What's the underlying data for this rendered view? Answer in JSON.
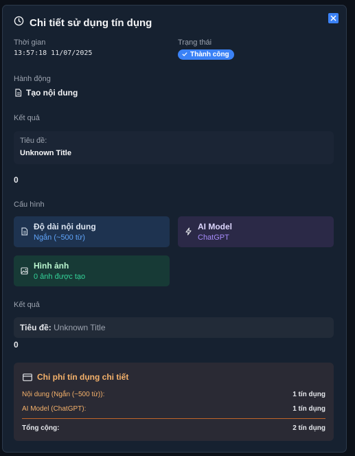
{
  "modal": {
    "title": "Chi tiết sử dụng tín dụng"
  },
  "time": {
    "label": "Thời gian",
    "value": "13:57:18 11/07/2025"
  },
  "status": {
    "label": "Trạng thái",
    "value": "Thành công"
  },
  "action": {
    "label": "Hành động",
    "value": "Tạo nội dung"
  },
  "result": {
    "label": "Kết quả",
    "title_label": "Tiêu đề:",
    "title_value": "Unknown Title",
    "count": "0"
  },
  "config": {
    "label": "Cấu hình",
    "items": [
      {
        "title": "Độ dài nội dung",
        "value": "Ngắn (~500 từ)",
        "icon": "document-icon"
      },
      {
        "title": "AI Model",
        "value": "ChatGPT",
        "icon": "lightning-icon"
      },
      {
        "title": "Hình ảnh",
        "value": "0 ảnh được tạo",
        "icon": "image-icon"
      }
    ]
  },
  "result2": {
    "label": "Kết quả",
    "title_label": "Tiêu đề:",
    "title_value": "Unknown Title",
    "count": "0"
  },
  "cost": {
    "title": "Chi phí tín dụng chi tiết",
    "rows": [
      {
        "label": "Nội dung (Ngắn (~500 từ)):",
        "value": "1 tín dụng"
      },
      {
        "label": "AI Model (ChatGPT):",
        "value": "1 tín dụng"
      }
    ],
    "total_label": "Tổng cộng:",
    "total_value": "2 tín dụng"
  },
  "colors": {
    "accent": "#3b82f6",
    "cost_orange": "#f6b26b",
    "green": "#34d399",
    "purple": "#a78bfa"
  }
}
